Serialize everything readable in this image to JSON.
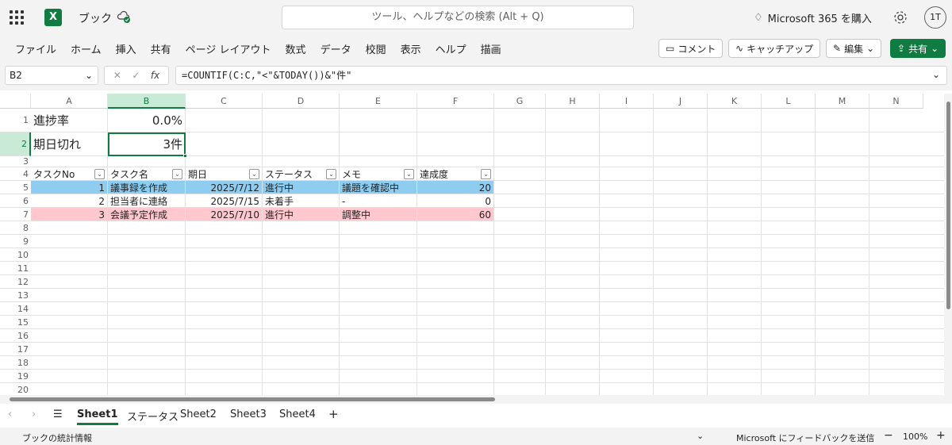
{
  "app": {
    "name": "ブック",
    "search_placeholder": "ツール、ヘルプなどの検索 (Alt + Q)",
    "ms365": "Microsoft 365 を購入",
    "avatar": "1T"
  },
  "ribbon": {
    "tabs": [
      "ファイル",
      "ホーム",
      "挿入",
      "共有",
      "ページ レイアウト",
      "数式",
      "データ",
      "校閲",
      "表示",
      "ヘルプ",
      "描画"
    ],
    "comment": "コメント",
    "catchup": "キャッチアップ",
    "edit": "編集",
    "share": "共有"
  },
  "formula_bar": {
    "name_box": "B2",
    "formula": "=COUNTIF(C:C,\"<\"&TODAY())&\"件\"",
    "fx": "fx"
  },
  "columns": [
    "A",
    "B",
    "C",
    "D",
    "E",
    "F",
    "G",
    "H",
    "I",
    "J",
    "K",
    "L",
    "M",
    "N"
  ],
  "rows": [
    "1",
    "2",
    "3",
    "4",
    "5",
    "6",
    "7",
    "8",
    "9",
    "10",
    "11",
    "12",
    "13",
    "14",
    "15",
    "16",
    "17",
    "18",
    "19",
    "20"
  ],
  "cells": {
    "A1": "進捗率",
    "B1": "0.0%",
    "A2": "期日切れ",
    "B2": "3件",
    "A4": "タスクNo",
    "B4": "タスク名",
    "C4": "期日",
    "D4": "ステータス",
    "E4": "メモ",
    "F4": "達成度",
    "A5": "1",
    "B5": "議事録を作成",
    "C5": "2025/7/12",
    "D5": "進行中",
    "E5": "議題を確認中",
    "F5": "20",
    "A6": "2",
    "B6": "担当者に連絡",
    "C6": "2025/7/15",
    "D6": "未着手",
    "E6": "-",
    "F6": "0",
    "A7": "3",
    "B7": "会議予定作成",
    "C7": "2025/7/10",
    "D7": "進行中",
    "E7": "調整中",
    "F7": "60"
  },
  "colors": {
    "row5": "#8fcdf0",
    "row7": "#ffc7ce",
    "accent": "#107c41"
  },
  "sheets": [
    "Sheet1",
    "ステータス",
    "Sheet2",
    "Sheet3",
    "Sheet4"
  ],
  "active_sheet": "Sheet1",
  "status": {
    "left": "ブックの統計情報",
    "feedback": "Microsoft にフィードバックを送信",
    "zoom": "100%"
  }
}
